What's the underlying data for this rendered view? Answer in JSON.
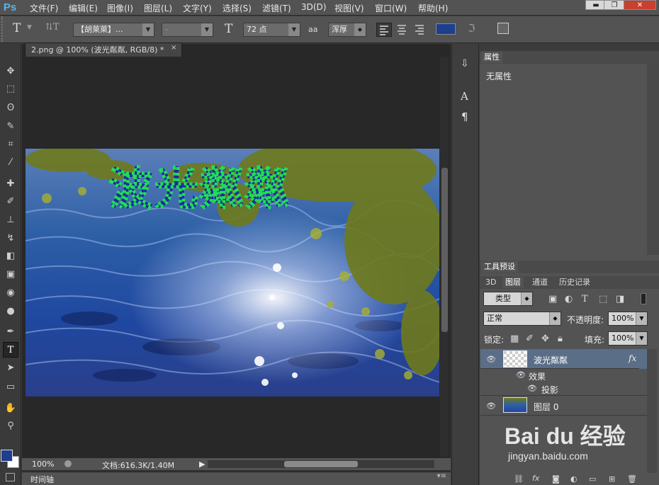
{
  "app": {
    "logo": "Ps"
  },
  "menu": [
    "文件(F)",
    "编辑(E)",
    "图像(I)",
    "图层(L)",
    "文字(Y)",
    "选择(S)",
    "滤镜(T)",
    "3D(D)",
    "视图(V)",
    "窗口(W)",
    "帮助(H)"
  ],
  "window_buttons": {
    "minimize": "▬",
    "restore": "❐",
    "close": "✕"
  },
  "options": {
    "tool_icon": "T",
    "orient_icon": "⇅T",
    "font_family": "【胡萊萊】...",
    "font_style": "-",
    "size_icon": "T",
    "font_size": "72 点",
    "aa_icon": "aa",
    "antialias": "浑厚",
    "text_color": "#1e3f8f"
  },
  "document": {
    "tab_title": "2.png @ 100% (波光粼粼, RGB/8) *",
    "close": "×",
    "overlay_text": "波光粼粼"
  },
  "status": {
    "zoom": "100%",
    "doc": "文档:616.3K/1.40M",
    "arrow": "▶"
  },
  "timeline": {
    "label": "时间轴"
  },
  "properties": {
    "title": "属性",
    "content": "无属性"
  },
  "panels": {
    "tool_presets": "工具预设",
    "tabs": [
      "3D",
      "图层",
      "通道",
      "历史记录"
    ],
    "active_tab": "图层"
  },
  "layers": {
    "filter_kind": "类型",
    "blend_mode": "正常",
    "opacity_label": "不透明度:",
    "opacity": "100%",
    "lock_label": "锁定:",
    "fill_label": "填充:",
    "fill": "100%",
    "items": [
      {
        "name": "波光粼粼",
        "fx": "fx"
      },
      {
        "name": "效果"
      },
      {
        "name": "投影"
      },
      {
        "name": "图层 0"
      }
    ]
  },
  "colors": {
    "foreground": "#1e3f8f",
    "background": "#ffffff",
    "accent": "#5ab4f0"
  },
  "watermark": {
    "brand": "Bai du 经验",
    "url": "jingyan.baidu.com"
  }
}
